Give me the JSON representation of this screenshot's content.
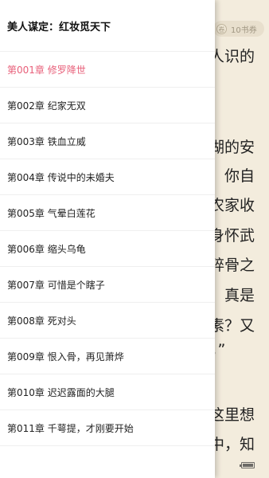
{
  "reader": {
    "coupon": {
      "icon": "coupon-icon",
      "icon_glyph": "卷",
      "label": "10书券"
    },
    "lines": [
      "人识的",
      "湖的安",
      "你自",
      "农家收",
      "身怀武",
      "碎骨之",
      "真是",
      "素？又",
      "，”",
      "这里想",
      "中，知"
    ],
    "battery_icon": "battery-icon"
  },
  "drawer": {
    "book_title": "美人谋定：红妆觅天下",
    "active_color": "#e8607a",
    "chapters": [
      {
        "label": "第001章 修罗降世",
        "active": true
      },
      {
        "label": "第002章 纪家无双",
        "active": false
      },
      {
        "label": "第003章 铁血立威",
        "active": false
      },
      {
        "label": "第004章 传说中的未婚夫",
        "active": false
      },
      {
        "label": "第005章 气晕白莲花",
        "active": false
      },
      {
        "label": "第006章 缩头乌龟",
        "active": false
      },
      {
        "label": "第007章 可惜是个瞎子",
        "active": false
      },
      {
        "label": "第008章 死对头",
        "active": false
      },
      {
        "label": "第009章 恨入骨，再见萧烨",
        "active": false
      },
      {
        "label": "第010章 迟迟露面的大腿",
        "active": false
      },
      {
        "label": "第011章 千萼提，才刚要开始",
        "active": false
      }
    ]
  }
}
